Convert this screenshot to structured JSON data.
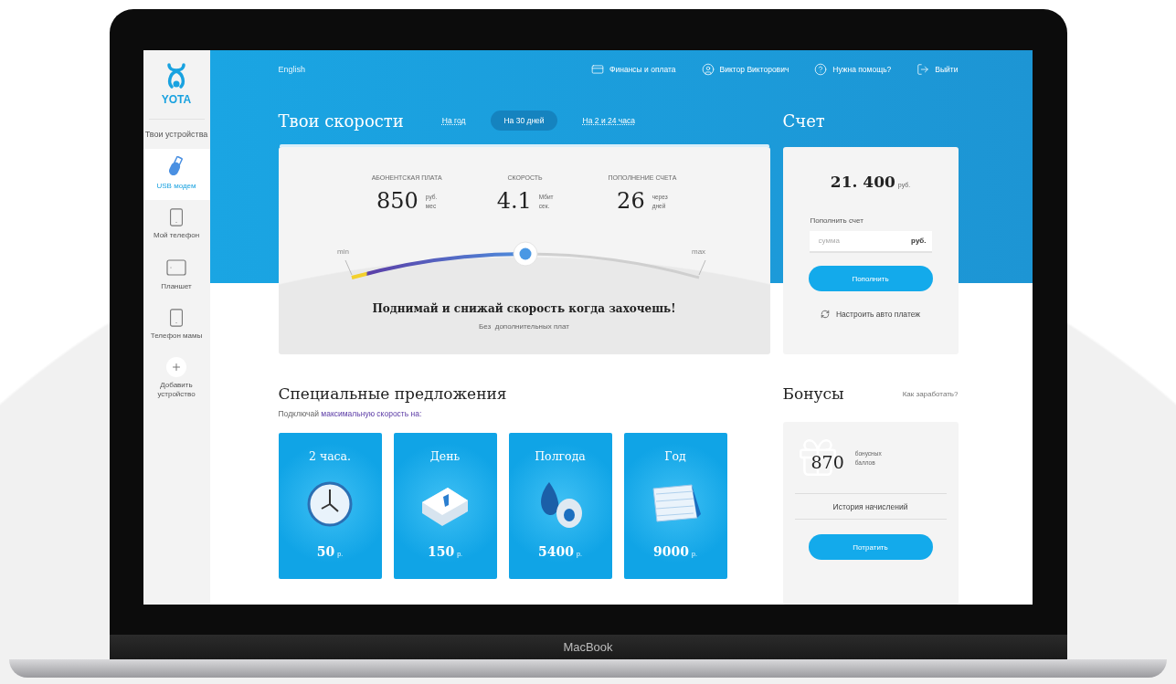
{
  "laptop": {
    "label": "MacBook"
  },
  "sidebar": {
    "logo": "YOTA",
    "heading": "Твои устройства",
    "items": [
      {
        "label": "USB модем",
        "kind": "usb-modem",
        "selected": true
      },
      {
        "label": "Мой телефон",
        "kind": "phone",
        "selected": false
      },
      {
        "label": "Планшет",
        "kind": "tablet",
        "selected": false
      },
      {
        "label": "Телефон мамы",
        "kind": "phone",
        "selected": false
      },
      {
        "label": "Добавить устройство",
        "kind": "add",
        "selected": false
      }
    ]
  },
  "header": {
    "language": "English",
    "links": [
      {
        "label": "Финансы и оплата",
        "kind": "payment"
      },
      {
        "label": "Виктор Викторович",
        "kind": "user"
      },
      {
        "label": "Нужна помощь?",
        "kind": "help"
      },
      {
        "label": "Выйти",
        "kind": "logout"
      }
    ]
  },
  "speed": {
    "title": "Твои скорости",
    "tabs": [
      {
        "label": "На год",
        "selected": false
      },
      {
        "label": "На 30 дней",
        "selected": true
      },
      {
        "label": "На 2 и 24 часа",
        "selected": false
      }
    ],
    "stats": [
      {
        "caption": "АБОНЕНТСКАЯ ПЛАТА",
        "value": "850",
        "unit_top": "руб.",
        "unit_bottom": "мес"
      },
      {
        "caption": "СКОРОСТЬ",
        "value": "4.1",
        "unit_top": "Мбит",
        "unit_bottom": "сек."
      },
      {
        "caption": "ПОПОЛНЕНИЕ СЧЕТА",
        "value": "26",
        "unit_top": "через",
        "unit_bottom": "дней"
      }
    ],
    "slider": {
      "min_label": "min",
      "max_label": "max",
      "level": 0.5
    },
    "headline": "Поднимай и снижай скорость когда захочешь!",
    "note": "Без  дополнительных плат"
  },
  "account": {
    "title": "Счет",
    "balance": "21. 400",
    "currency": "руб.",
    "topup_label": "Пополнить счет",
    "amount_placeholder": "сумма",
    "amount_unit": "руб.",
    "button": "Пополнить",
    "auto_payment": "Настроить авто платеж"
  },
  "offers": {
    "title": "Специальные предложения",
    "subtitle": "Подключай **максимальную скорость на:**",
    "tiles": [
      {
        "title": "2 часа.",
        "kind": "clock",
        "price": "50",
        "unit": "р."
      },
      {
        "title": "День",
        "kind": "tear-calendar",
        "price": "150",
        "unit": "р."
      },
      {
        "title": "Полгода",
        "kind": "drop",
        "price": "5400",
        "unit": "р."
      },
      {
        "title": "Год",
        "kind": "desk-calendar",
        "price": "9000",
        "unit": "р."
      }
    ]
  },
  "bonuses": {
    "title": "Бонусы",
    "link": "Как заработать?",
    "points": "870",
    "unit_top": "бонусных",
    "unit_bottom": "баллов",
    "history": "История начислений",
    "button": "Потратить"
  }
}
